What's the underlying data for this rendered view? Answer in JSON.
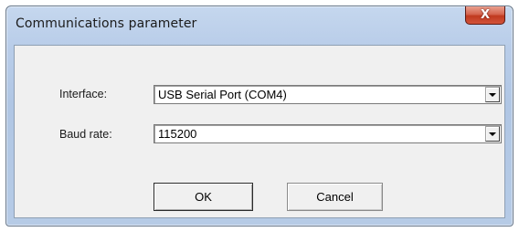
{
  "dialog": {
    "title": "Communications parameter",
    "close_glyph": "X"
  },
  "fields": {
    "interface": {
      "label": "Interface:",
      "value": "USB Serial Port (COM4)"
    },
    "baud_rate": {
      "label": "Baud rate:",
      "value": "115200"
    }
  },
  "buttons": {
    "ok_label": "OK",
    "cancel_label": "Cancel"
  },
  "icons": {
    "close": "close-icon",
    "dropdown": "chevron-down-icon"
  },
  "colors": {
    "close_button": "#c0391f",
    "frame": "#b9cde9",
    "client_background": "#f0f0f0"
  }
}
